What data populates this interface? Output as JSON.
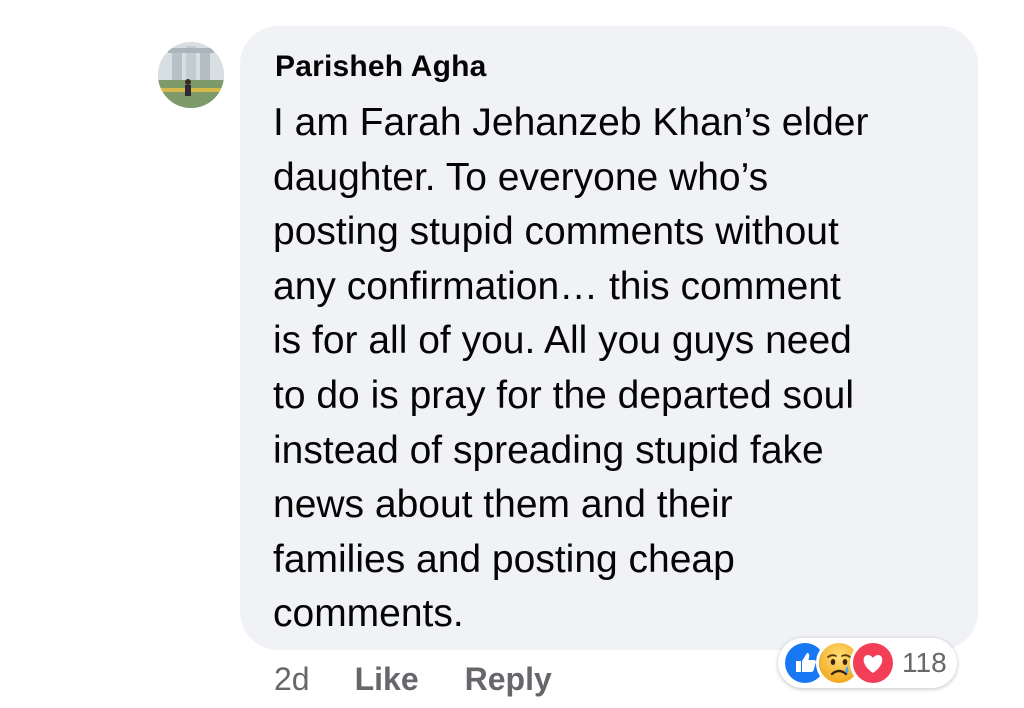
{
  "comment": {
    "author": "Parisheh Agha",
    "lines": [
      "I am Farah Jehanzeb Khan’s elder",
      "daughter. To everyone who’s",
      "posting stupid comments without",
      "any confirmation… this comment",
      "is for all of you. All you guys need",
      "to do is pray for the departed soul",
      "instead of spreading stupid fake",
      "news about them and their",
      "families and posting cheap",
      "comments."
    ],
    "age": "2d",
    "like_label": "Like",
    "reply_label": "Reply",
    "reactions": {
      "icons": [
        "like-icon",
        "sad-icon",
        "love-icon"
      ],
      "count": "118"
    }
  },
  "colors": {
    "bubble": "#f0f2f5",
    "text": "#050505",
    "secondary_text": "#65676b",
    "like_blue": "#1877f2",
    "love_red": "#f33e58",
    "sad_yellow": "#f7b125"
  }
}
